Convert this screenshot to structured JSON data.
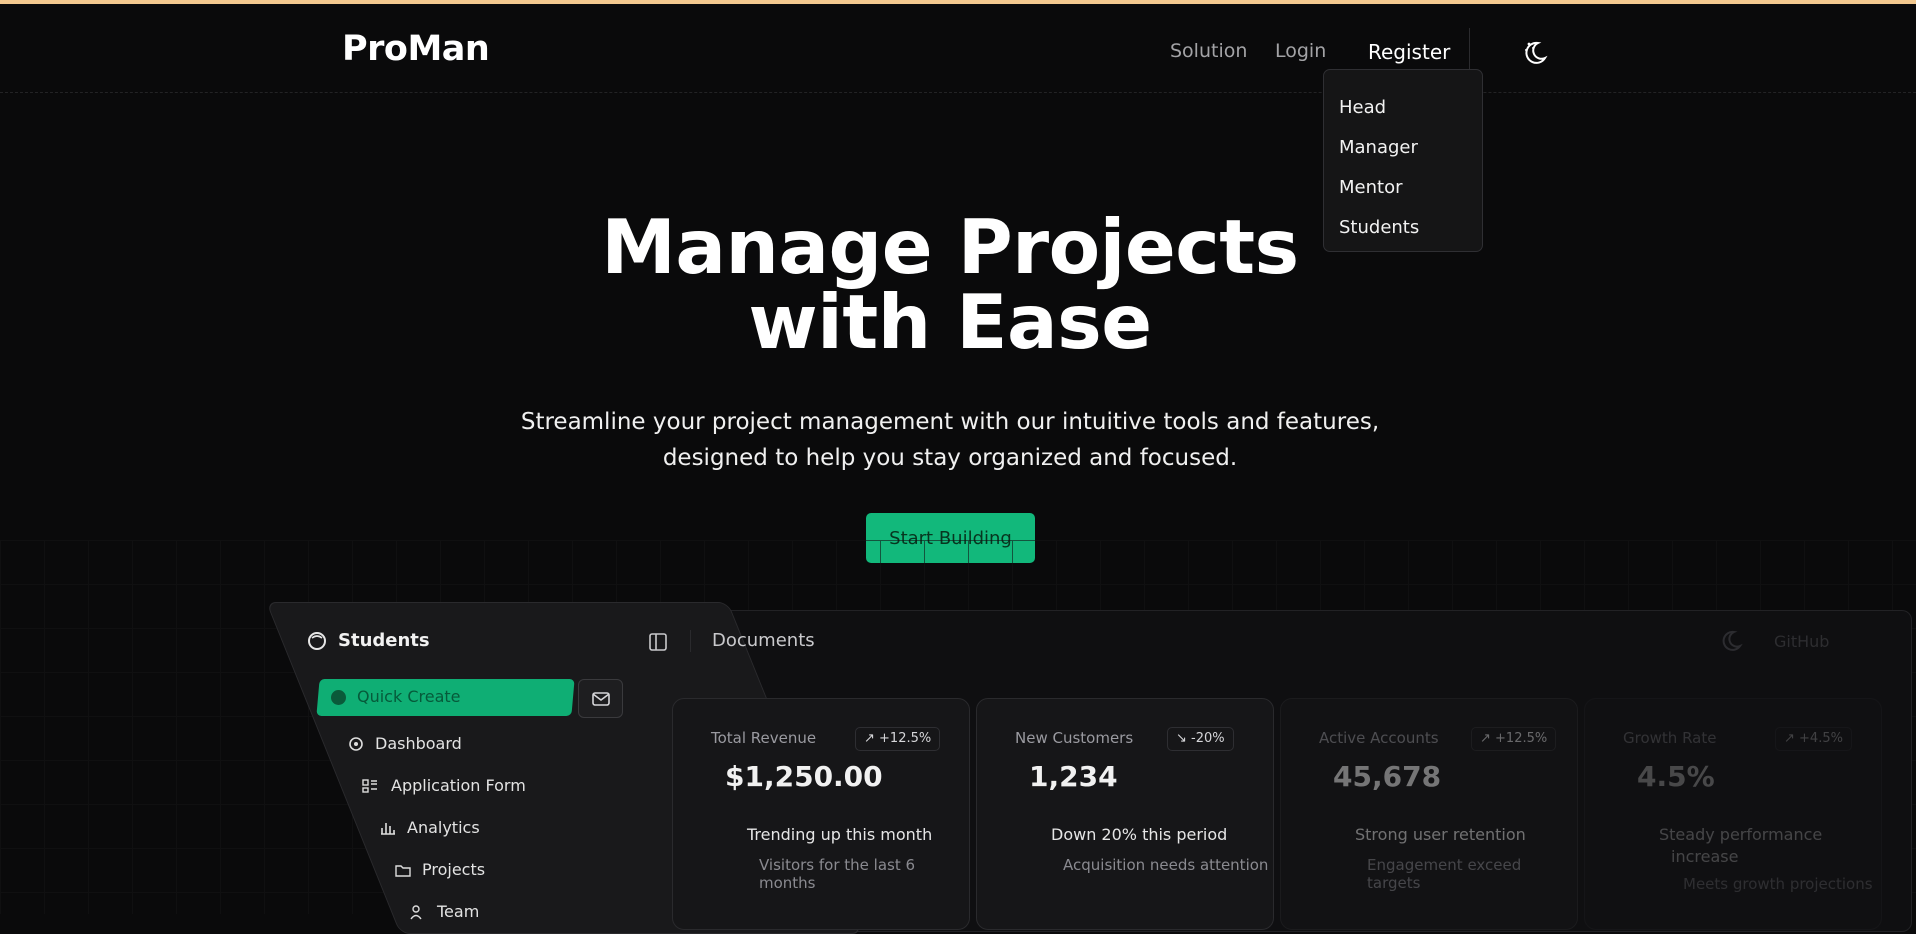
{
  "header": {
    "logo": "ProMan",
    "nav": {
      "solution": "Solution",
      "login": "Login",
      "register": "Register"
    },
    "theme_icon": "moon-stars-icon"
  },
  "register_menu": [
    "Head",
    "Manager",
    "Mentor",
    "Students"
  ],
  "hero": {
    "title_line1": "Manage Projects",
    "title_line2": "with Ease",
    "subtitle_line1": "Streamline your project management with our intuitive tools and features,",
    "subtitle_line2": "designed to help you stay organized and focused.",
    "cta": "Start Building"
  },
  "preview": {
    "sidebar": {
      "title": "Students",
      "quick_create": "Quick Create",
      "items": [
        "Dashboard",
        "Application Form",
        "Analytics",
        "Projects",
        "Team"
      ]
    },
    "topbar": {
      "crumb": "Documents",
      "right_link": "GitHub"
    },
    "cards": [
      {
        "label": "Total Revenue",
        "badge": "↗ +12.5%",
        "value": "$1,250.00",
        "trend": "Trending up this month",
        "desc": "Visitors for the last 6 months"
      },
      {
        "label": "New Customers",
        "badge": "↘ -20%",
        "value": "1,234",
        "trend": "Down 20% this period",
        "desc": "Acquisition needs attention"
      },
      {
        "label": "Active Accounts",
        "badge": "↗ +12.5%",
        "value": "45,678",
        "trend": "Strong user retention",
        "desc": "Engagement exceed targets"
      },
      {
        "label": "Growth Rate",
        "badge": "↗ +4.5%",
        "value": "4.5%",
        "trend_line1": "Steady performance",
        "trend_line2": "increase",
        "desc": "Meets growth projections"
      }
    ]
  },
  "colors": {
    "accent": "#12b87b",
    "background": "#0a0a0b",
    "top_border": "#f3c98f"
  }
}
